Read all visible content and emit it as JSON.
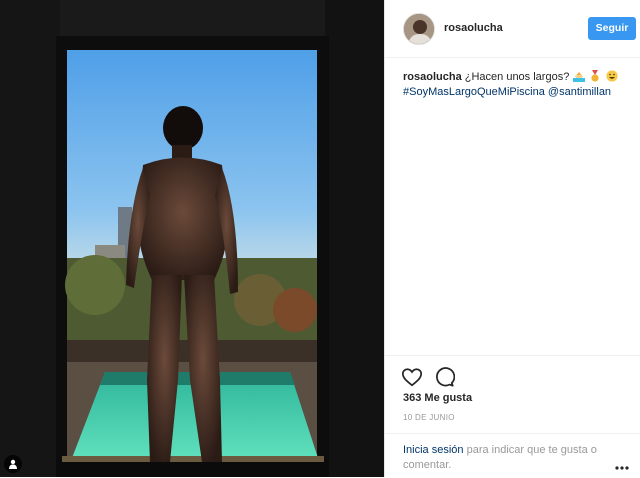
{
  "post": {
    "username": "rosaolucha",
    "follow_label": "Seguir",
    "caption_username": "rosaolucha",
    "caption_text": "¿Hacen unos largos?",
    "caption_emojis": [
      "house-with-pool-emoji",
      "medal-emoji",
      "grinning-emoji"
    ],
    "hashtag": "#SoyMasLargoQueMiPiscina",
    "mention": "@santimillan",
    "likes": "363 Me gusta",
    "date": "10 DE JUNIO",
    "login_link": "Inicia sesión",
    "login_rest": "para indicar que te gusta o comentar."
  },
  "icons": {
    "like": "heart-icon",
    "comment": "comment-icon",
    "more": "more-options-icon",
    "user_tag": "user-tag-icon"
  },
  "colors": {
    "follow_button": "#3897f0",
    "link": "#003569",
    "muted_text": "#999999"
  }
}
